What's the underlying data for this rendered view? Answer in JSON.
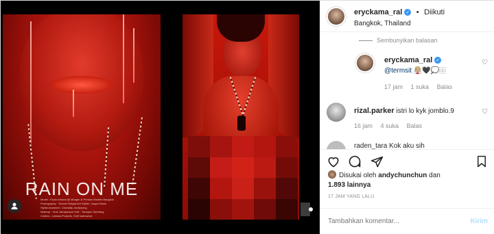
{
  "post": {
    "poster_title": "RAIN ON ME",
    "credits": "Model : Eryck Amaral @ Morgan & Preston Models Bangkok\nPhotography : Terfvat Sirisparnch Stylist : Isaya Oraan\nStylist Assistant : Chanatip Jantawong\nMakeup : Vruk Jarrapanpor Hair : Tanapon Saeriang\nClothes : Lattana Projects, SLW swimwear"
  },
  "header": {
    "username": "eryckama_ral",
    "separator": "•",
    "follow_label": "Diikuti",
    "location": "Bangkok, Thailand"
  },
  "comments": {
    "hide_replies": "Sembunyikan balasan",
    "reply": {
      "username": "eryckama_ral",
      "mention": "@termsit",
      "emoji": " 👰🏼🖤💭🏼",
      "time": "17 jam",
      "likes": "1 suka",
      "reply_label": "Balas"
    },
    "comment2": {
      "username": "rizal.parker",
      "text": "istri lo kyk jomblo.9",
      "time": "16 jam",
      "likes": "4 suka",
      "reply_label": "Balas"
    },
    "comment3": {
      "partial_text": "raden_tara   Kok aku sih"
    }
  },
  "likes": {
    "prefix": "Disukai oleh ",
    "user": "andychunchun",
    "conj": " dan",
    "others": "1.893 lainnya"
  },
  "timestamp": "17 JAM YANG LALU",
  "comment_box": {
    "placeholder": "Tambahkan komentar...",
    "post_label": "Kirim"
  },
  "colors": {
    "verified": "#3897f0",
    "post_button": "#b2dffc",
    "link": "#00376b",
    "muted": "#8e8e8e"
  },
  "icons": [
    "heart-icon",
    "comment-icon",
    "share-icon",
    "bookmark-icon",
    "verified-badge-icon",
    "user-tag-icon"
  ]
}
